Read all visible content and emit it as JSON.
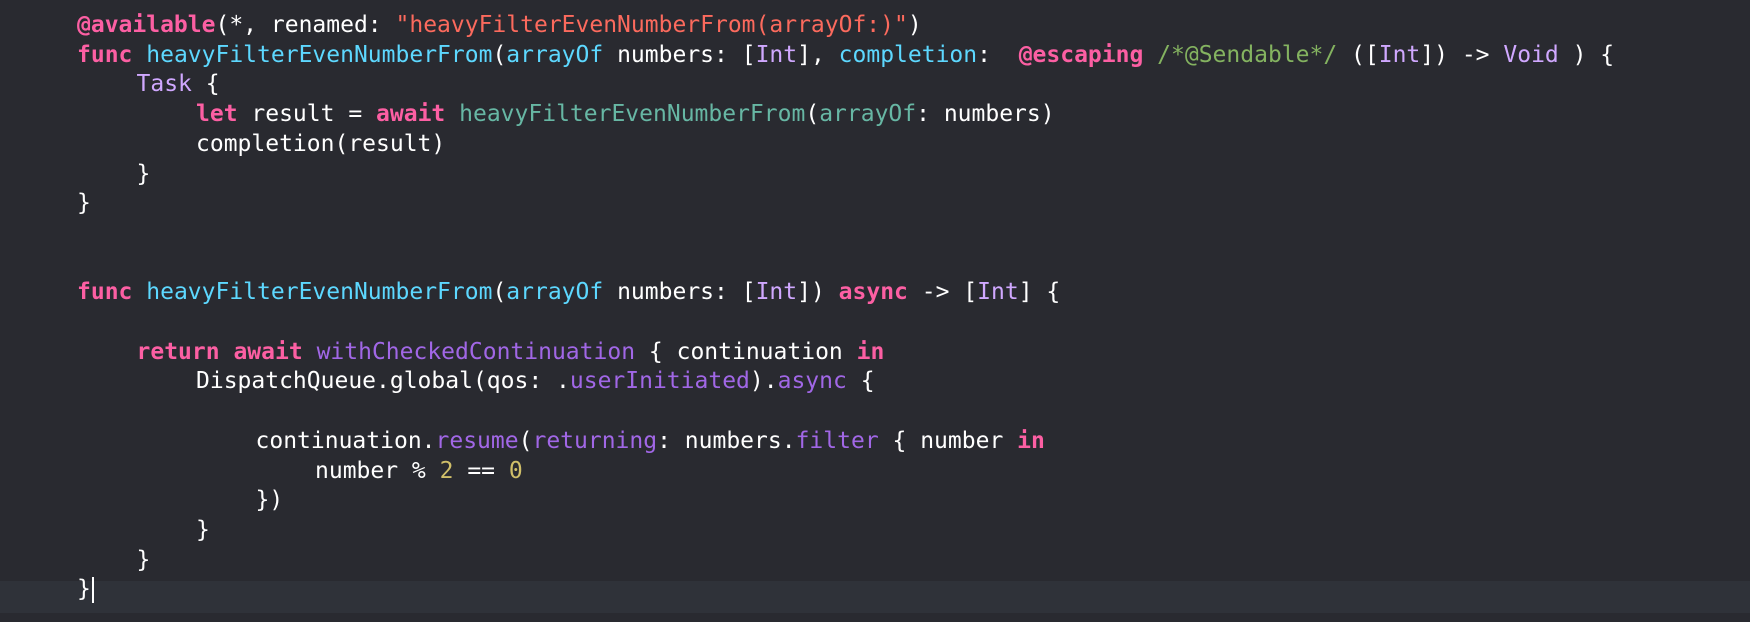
{
  "editor": {
    "lines": [
      {
        "indent": 0,
        "tokens": [
          {
            "t": "attr",
            "v": "@available"
          },
          {
            "t": "plain",
            "v": "(*, renamed: "
          },
          {
            "t": "str",
            "v": "\"heavyFilterEvenNumberFrom(arrayOf:)\""
          },
          {
            "t": "plain",
            "v": ")"
          }
        ]
      },
      {
        "indent": 0,
        "tokens": [
          {
            "t": "kw",
            "v": "func"
          },
          {
            "t": "plain",
            "v": " "
          },
          {
            "t": "fn",
            "v": "heavyFilterEvenNumberFrom"
          },
          {
            "t": "plain",
            "v": "("
          },
          {
            "t": "param",
            "v": "arrayOf"
          },
          {
            "t": "plain",
            "v": " numbers: ["
          },
          {
            "t": "type",
            "v": "Int"
          },
          {
            "t": "plain",
            "v": "], "
          },
          {
            "t": "param",
            "v": "completion"
          },
          {
            "t": "plain",
            "v": ":  "
          },
          {
            "t": "attr",
            "v": "@escaping"
          },
          {
            "t": "plain",
            "v": " "
          },
          {
            "t": "cmt",
            "v": "/*@Sendable*/"
          },
          {
            "t": "plain",
            "v": " (["
          },
          {
            "t": "type",
            "v": "Int"
          },
          {
            "t": "plain",
            "v": "]) -> "
          },
          {
            "t": "type",
            "v": "Void"
          },
          {
            "t": "plain",
            "v": " ) {"
          }
        ]
      },
      {
        "indent": 1,
        "tokens": [
          {
            "t": "type",
            "v": "Task"
          },
          {
            "t": "plain",
            "v": " {"
          }
        ]
      },
      {
        "indent": 2,
        "tokens": [
          {
            "t": "kw",
            "v": "let"
          },
          {
            "t": "plain",
            "v": " result = "
          },
          {
            "t": "kw",
            "v": "await"
          },
          {
            "t": "plain",
            "v": " "
          },
          {
            "t": "fnuse",
            "v": "heavyFilterEvenNumberFrom"
          },
          {
            "t": "plain",
            "v": "("
          },
          {
            "t": "fnuse",
            "v": "arrayOf"
          },
          {
            "t": "plain",
            "v": ": numbers)"
          }
        ]
      },
      {
        "indent": 2,
        "tokens": [
          {
            "t": "plain",
            "v": "completion(result)"
          }
        ]
      },
      {
        "indent": 1,
        "tokens": [
          {
            "t": "plain",
            "v": "}"
          }
        ]
      },
      {
        "indent": 0,
        "tokens": [
          {
            "t": "plain",
            "v": "}"
          }
        ]
      },
      {
        "indent": 0,
        "tokens": []
      },
      {
        "indent": 0,
        "tokens": []
      },
      {
        "indent": 0,
        "tokens": [
          {
            "t": "kw",
            "v": "func"
          },
          {
            "t": "plain",
            "v": " "
          },
          {
            "t": "fn",
            "v": "heavyFilterEvenNumberFrom"
          },
          {
            "t": "plain",
            "v": "("
          },
          {
            "t": "param",
            "v": "arrayOf"
          },
          {
            "t": "plain",
            "v": " numbers: ["
          },
          {
            "t": "type",
            "v": "Int"
          },
          {
            "t": "plain",
            "v": "]) "
          },
          {
            "t": "kw",
            "v": "async"
          },
          {
            "t": "plain",
            "v": " -> ["
          },
          {
            "t": "type",
            "v": "Int"
          },
          {
            "t": "plain",
            "v": "] {"
          }
        ]
      },
      {
        "indent": 0,
        "tokens": []
      },
      {
        "indent": 1,
        "tokens": [
          {
            "t": "kw",
            "v": "return"
          },
          {
            "t": "plain",
            "v": " "
          },
          {
            "t": "kw",
            "v": "await"
          },
          {
            "t": "plain",
            "v": " "
          },
          {
            "t": "sys",
            "v": "withCheckedContinuation"
          },
          {
            "t": "plain",
            "v": " { continuation "
          },
          {
            "t": "kw",
            "v": "in"
          }
        ]
      },
      {
        "indent": 2,
        "tokens": [
          {
            "t": "plain",
            "v": "DispatchQueue.global(qos: ."
          },
          {
            "t": "member",
            "v": "userInitiated"
          },
          {
            "t": "plain",
            "v": ")."
          },
          {
            "t": "member",
            "v": "async"
          },
          {
            "t": "plain",
            "v": " {"
          }
        ]
      },
      {
        "indent": 0,
        "tokens": []
      },
      {
        "indent": 3,
        "tokens": [
          {
            "t": "plain",
            "v": "continuation."
          },
          {
            "t": "member",
            "v": "resume"
          },
          {
            "t": "plain",
            "v": "("
          },
          {
            "t": "member",
            "v": "returning"
          },
          {
            "t": "plain",
            "v": ": numbers."
          },
          {
            "t": "member",
            "v": "filter"
          },
          {
            "t": "plain",
            "v": " { number "
          },
          {
            "t": "kw",
            "v": "in"
          }
        ]
      },
      {
        "indent": 4,
        "tokens": [
          {
            "t": "plain",
            "v": "number % "
          },
          {
            "t": "num",
            "v": "2"
          },
          {
            "t": "plain",
            "v": " == "
          },
          {
            "t": "num",
            "v": "0"
          }
        ]
      },
      {
        "indent": 3,
        "tokens": [
          {
            "t": "plain",
            "v": "})"
          }
        ]
      },
      {
        "indent": 2,
        "tokens": [
          {
            "t": "plain",
            "v": "}"
          }
        ]
      },
      {
        "indent": 1,
        "tokens": [
          {
            "t": "plain",
            "v": "}"
          }
        ]
      },
      {
        "indent": 0,
        "tokens": [
          {
            "t": "plain",
            "v": "}"
          }
        ],
        "current": true
      }
    ]
  }
}
